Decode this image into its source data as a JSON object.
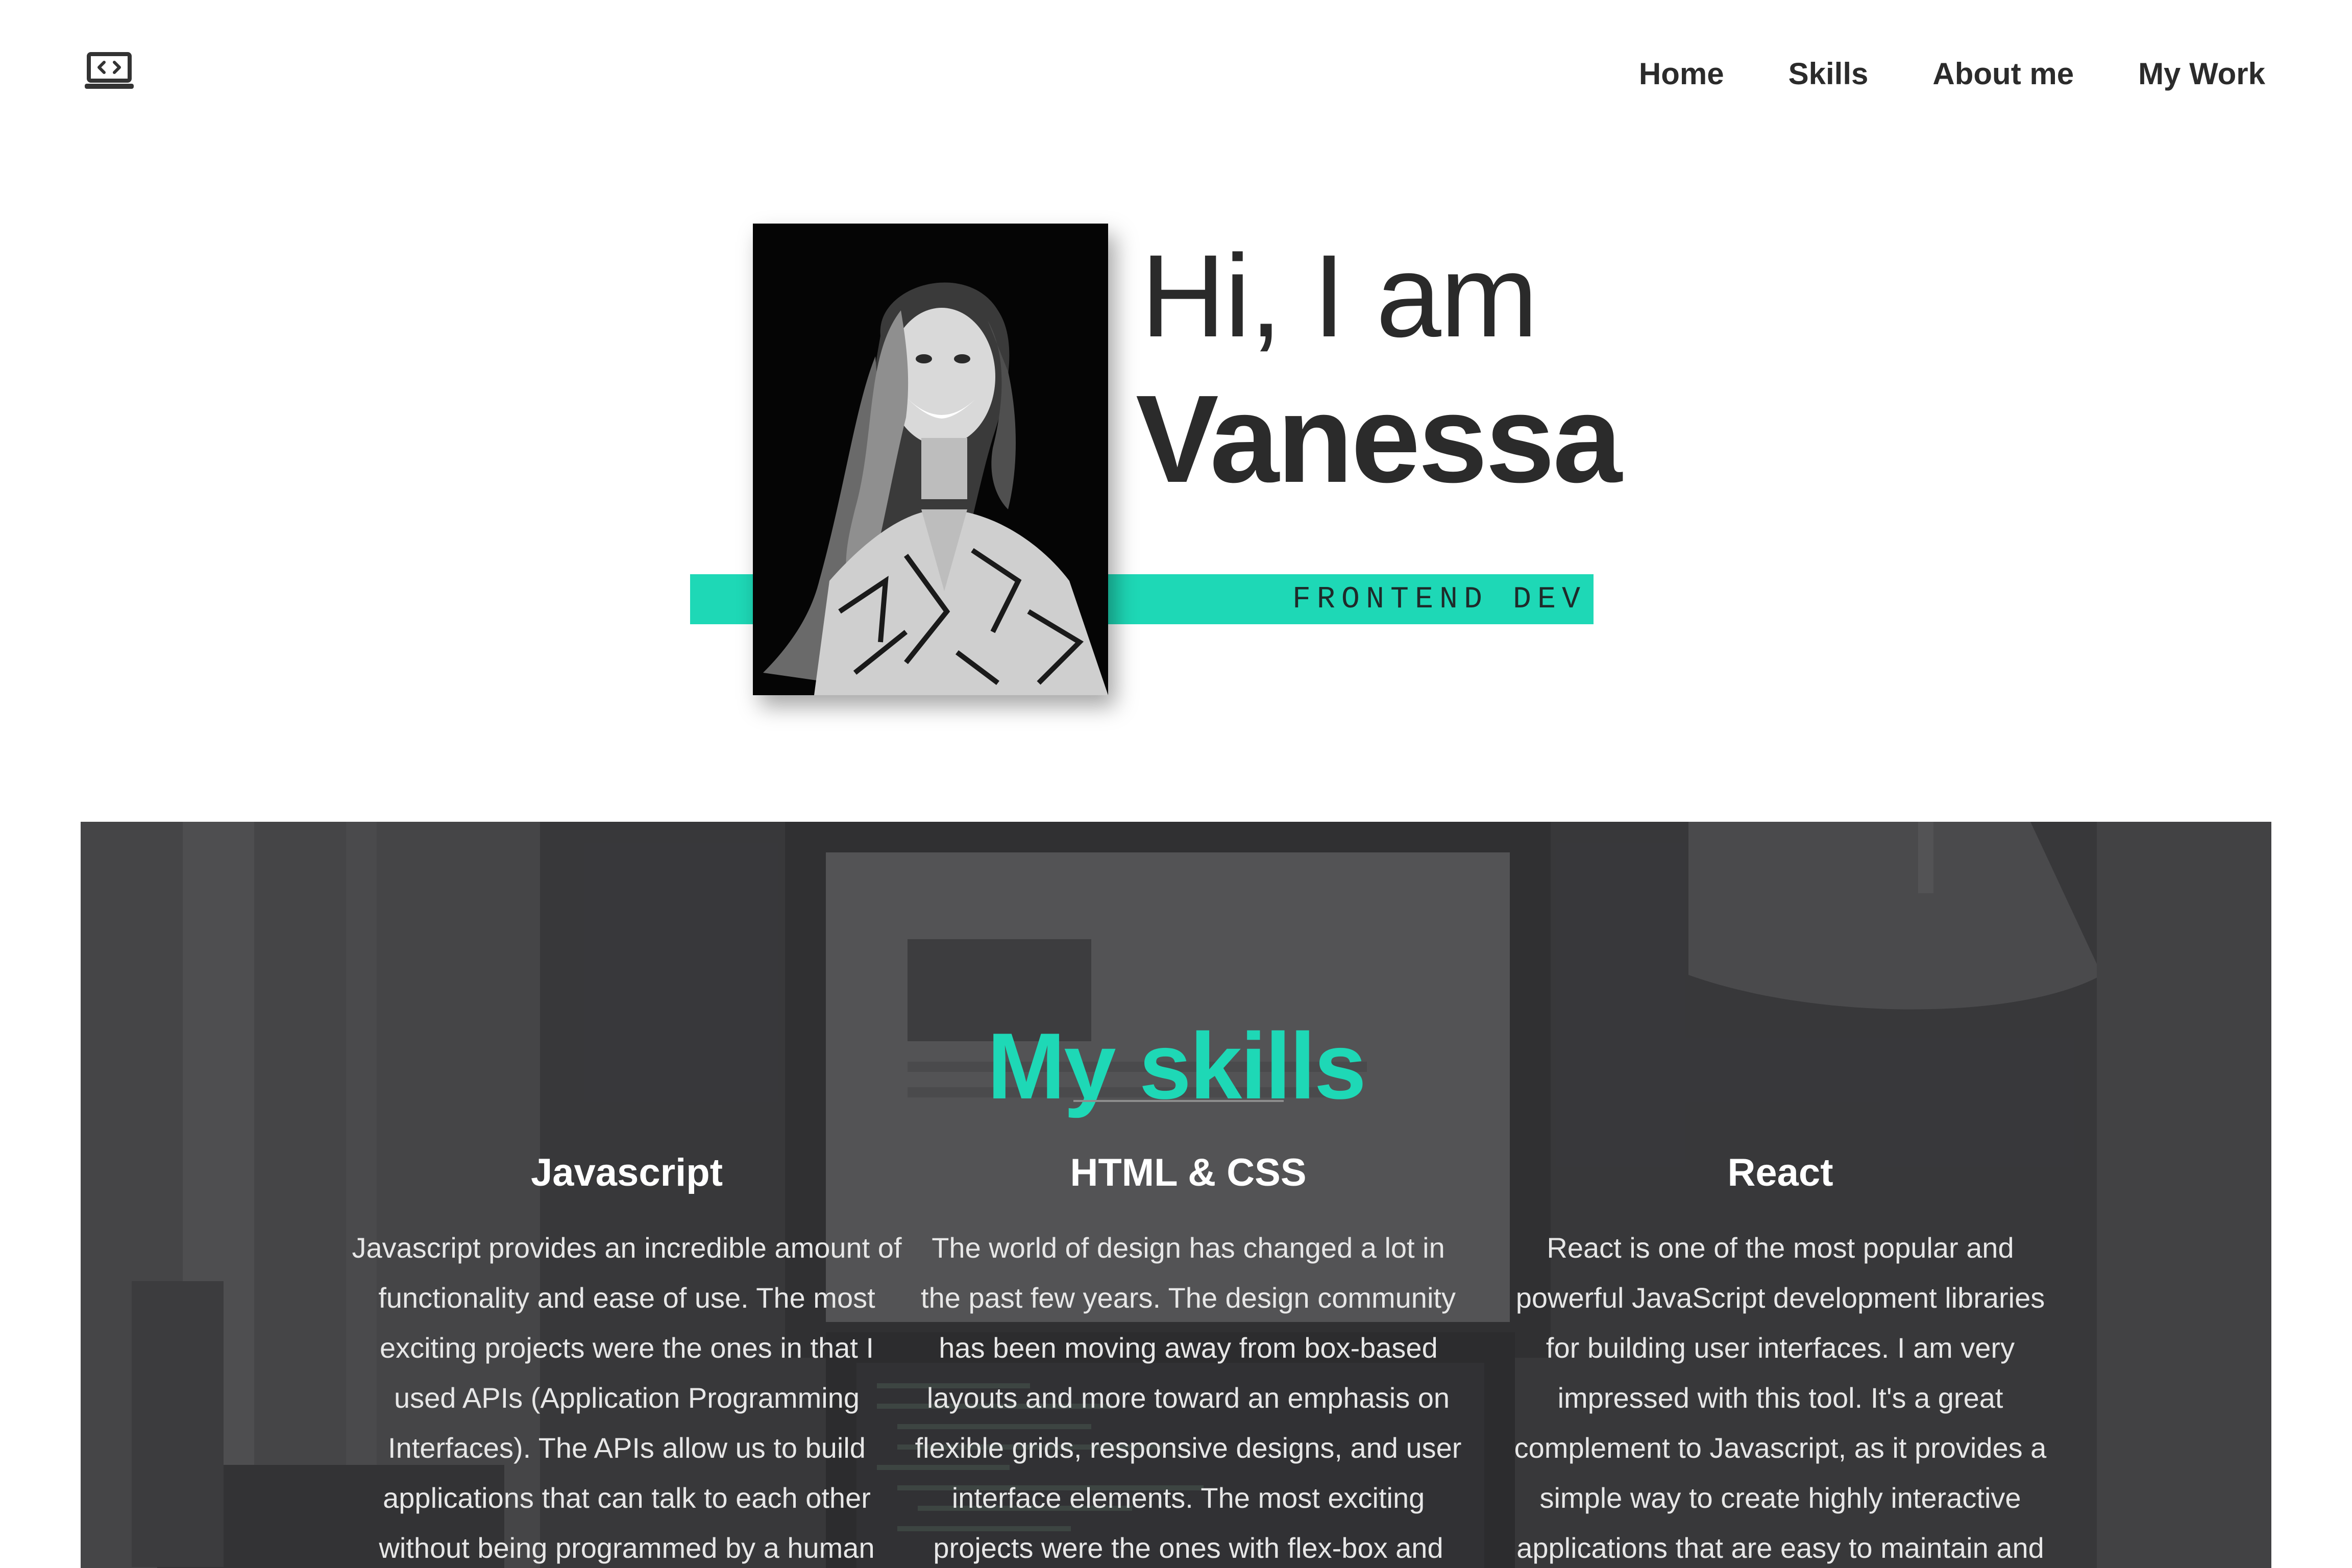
{
  "nav": {
    "logo_icon": "laptop-code-icon",
    "links": [
      {
        "label": "Home"
      },
      {
        "label": "Skills"
      },
      {
        "label": "About me"
      },
      {
        "label": "My Work"
      }
    ]
  },
  "hero": {
    "greeting": "Hi, I am",
    "name": "Vanessa",
    "role": "FRONTEND DEV",
    "accent_color": "#1ed8b6"
  },
  "skills": {
    "title": "My skills",
    "title_color": "#1ed8b6",
    "items": [
      {
        "title": "Javascript",
        "text": "Javascript provides an incredible amount of functionality and ease of use. The most exciting projects were the ones in that I used APIs (Application Programming Interfaces). The APIs allow us to build applications that can talk to each other without being programmed by a human"
      },
      {
        "title": "HTML & CSS",
        "text": "The world of design has changed a lot in the past few years. The design community has been moving away from box-based layouts and more toward an emphasis on flexible grids, responsive designs, and user interface elements. The most exciting projects were the ones with flex-box and applying UI rules"
      },
      {
        "title": "React",
        "text": "React is one of the most popular and powerful JavaScript development libraries for building user interfaces. I am very impressed with this tool. It's a great complement to Javascript, as it provides a simple way to create highly interactive applications that are easy to maintain and"
      }
    ]
  }
}
